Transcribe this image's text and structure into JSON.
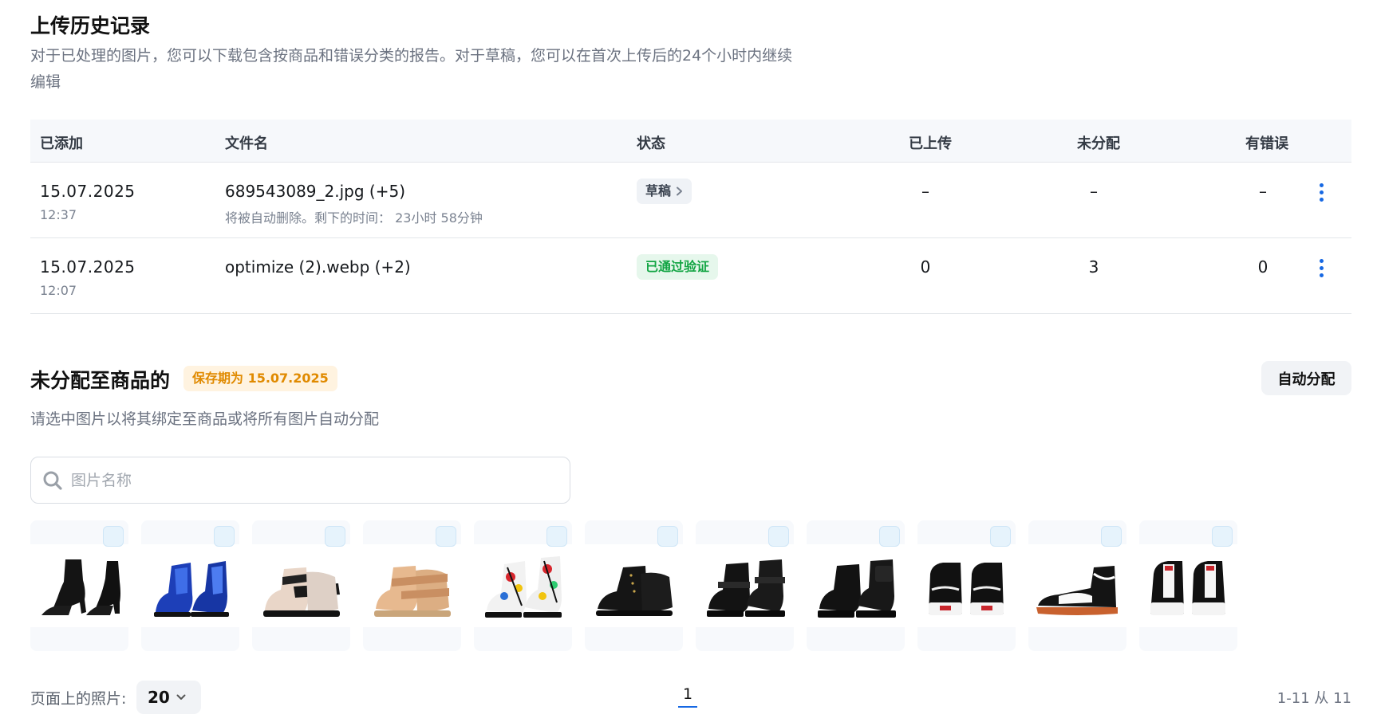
{
  "history": {
    "title": "上传历史记录",
    "description": "对于已处理的图片，您可以下载包含按商品和错误分类的报告。对于草稿，您可以在首次上传后的24个小时内继续编辑",
    "columns": {
      "added": "已添加",
      "filename": "文件名",
      "status": "状态",
      "uploaded": "已上传",
      "unassigned": "未分配",
      "errors": "有错误"
    },
    "rows": [
      {
        "date": "15.07.2025",
        "time": "12:37",
        "filename": "689543089_2.jpg (+5)",
        "subtext": "将被自动删除。剩下的时间： 23小时 58分钟",
        "status": "草稿",
        "uploaded": "–",
        "unassigned": "–",
        "errors": "–"
      },
      {
        "date": "15.07.2025",
        "time": "12:07",
        "filename": "optimize (2).webp (+2)",
        "subtext": "",
        "status": "已通过验证",
        "uploaded": "0",
        "unassigned": "3",
        "errors": "0"
      }
    ]
  },
  "unassigned": {
    "title": "未分配至商品的",
    "keep_badge": "保存期为 15.07.2025",
    "auto_button": "自动分配",
    "description": "请选中图片以将其绑定至商品或将所有图片自动分配",
    "search_placeholder": "图片名称",
    "images": [
      {
        "icon": "black-heeled-ankle-boot"
      },
      {
        "icon": "blue-metallic-boot"
      },
      {
        "icon": "beige-black-strap-boot"
      },
      {
        "icon": "gold-strap-boot"
      },
      {
        "icon": "graffiti-combat-boot"
      },
      {
        "icon": "black-studded-ankle-boot"
      },
      {
        "icon": "black-buckle-boot"
      },
      {
        "icon": "black-pocket-combat-boot"
      },
      {
        "icon": "black-white-high-top-sneakers"
      },
      {
        "icon": "black-high-top-sneaker-side"
      },
      {
        "icon": "black-white-high-top-sneakers-laced"
      }
    ]
  },
  "footer": {
    "per_page_label": "页面上的照片:",
    "per_page_value": "20",
    "current_page": "1",
    "range": "1-11 从 11"
  },
  "colors": {
    "accent": "#1668e3",
    "success": "#13a544",
    "warning": "#e08a00"
  }
}
